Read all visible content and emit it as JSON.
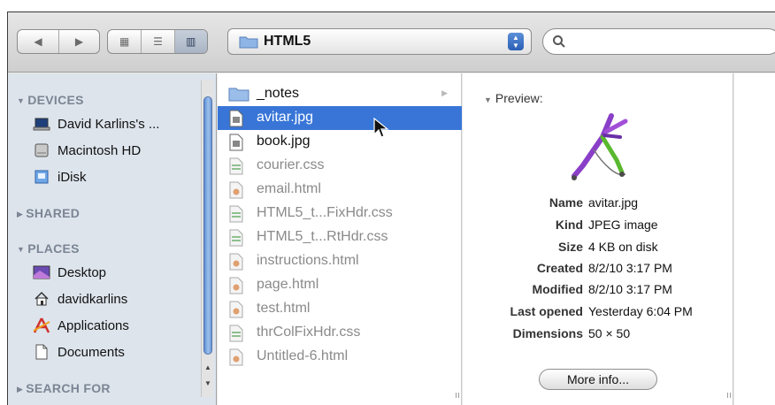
{
  "toolbar": {
    "nav_back": "◀",
    "nav_forward": "▶",
    "view_icon": "▦",
    "view_list": "☰",
    "view_columns": "▥",
    "path_label": "HTML5",
    "search_placeholder": ""
  },
  "sidebar": {
    "devices_header": "DEVICES",
    "devices": [
      {
        "label": "David Karlins's ...",
        "icon": "laptop-icon"
      },
      {
        "label": "Macintosh HD",
        "icon": "hard-drive-icon"
      },
      {
        "label": "iDisk",
        "icon": "idisk-icon"
      }
    ],
    "shared_header": "SHARED",
    "places_header": "PLACES",
    "places": [
      {
        "label": "Desktop",
        "icon": "desktop-icon"
      },
      {
        "label": "davidkarlins",
        "icon": "home-icon"
      },
      {
        "label": "Applications",
        "icon": "applications-icon"
      },
      {
        "label": "Documents",
        "icon": "documents-icon"
      }
    ],
    "search_header": "SEARCH FOR"
  },
  "files": [
    {
      "name": "_notes",
      "type": "folder"
    },
    {
      "name": "avitar.jpg",
      "type": "image",
      "selected": true
    },
    {
      "name": "book.jpg",
      "type": "image"
    },
    {
      "name": "courier.css",
      "type": "css"
    },
    {
      "name": "email.html",
      "type": "html"
    },
    {
      "name": "HTML5_t...FixHdr.css",
      "type": "css"
    },
    {
      "name": "HTML5_t...RtHdr.css",
      "type": "css"
    },
    {
      "name": "instructions.html",
      "type": "html"
    },
    {
      "name": "page.html",
      "type": "html"
    },
    {
      "name": "test.html",
      "type": "html"
    },
    {
      "name": "thrColFixHdr.css",
      "type": "css"
    },
    {
      "name": "Untitled-6.html",
      "type": "html"
    }
  ],
  "preview": {
    "title": "Preview:",
    "meta": [
      {
        "key": "Name",
        "value": "avitar.jpg"
      },
      {
        "key": "Kind",
        "value": "JPEG image"
      },
      {
        "key": "Size",
        "value": "4 KB on disk"
      },
      {
        "key": "Created",
        "value": "8/2/10 3:17 PM"
      },
      {
        "key": "Modified",
        "value": "8/2/10 3:17 PM"
      },
      {
        "key": "Last opened",
        "value": "Yesterday 6:04 PM"
      },
      {
        "key": "Dimensions",
        "value": "50 × 50"
      }
    ],
    "more_info_label": "More info..."
  },
  "colors": {
    "selection": "#3875d7",
    "sidebar_bg": "#dde4ec",
    "sidebar_header": "#7b8594"
  }
}
